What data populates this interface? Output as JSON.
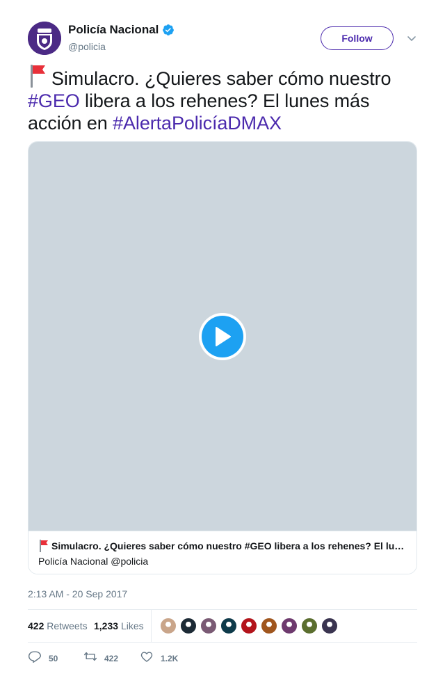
{
  "account": {
    "name": "Policía Nacional",
    "handle": "@policia",
    "follow_label": "Follow"
  },
  "tweet": {
    "text_part1": "Simulacro. ¿Quieres saber cómo nuestro ",
    "hashtag1": "#GEO",
    "text_part2": "  libera a los rehenes? El lunes más acción en ",
    "hashtag2": "#AlertaPolicíaDMAX",
    "timestamp": "2:13 AM - 20 Sep 2017"
  },
  "card": {
    "title": "Simulacro. ¿Quieres saber cómo nuestro #GEO libera a los rehenes? El lunes más acción en #AlertaPolicíaDMAX",
    "subtitle": "Policía Nacional @policia"
  },
  "stats": {
    "retweets_count": "422",
    "retweets_label": "Retweets",
    "likes_count": "1,233",
    "likes_label": "Likes"
  },
  "likers": [
    {
      "color": "#c9a58a"
    },
    {
      "color": "#1c2a35"
    },
    {
      "color": "#7a5a74"
    },
    {
      "color": "#0e3a4a"
    },
    {
      "color": "#b3141b"
    },
    {
      "color": "#a0561e"
    },
    {
      "color": "#6e3a6e"
    },
    {
      "color": "#5b6e2f"
    },
    {
      "color": "#3a3450"
    }
  ],
  "actions": {
    "reply_count": "50",
    "retweet_count": "422",
    "like_count": "1.2K"
  },
  "colors": {
    "brand_purple": "#4b2aad",
    "verified_blue": "#1da1f2",
    "video_bg": "#ccd6dd",
    "muted_text": "#657786"
  }
}
